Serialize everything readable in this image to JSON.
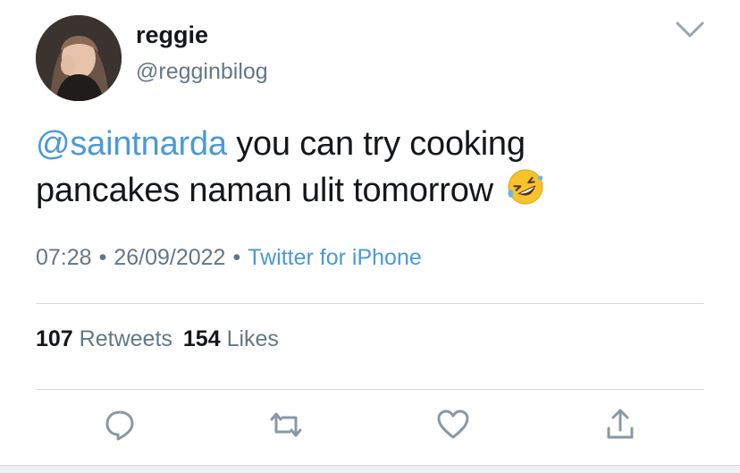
{
  "user": {
    "display_name": "reggie",
    "handle": "@regginbilog"
  },
  "tweet": {
    "mention": "@saintnarda",
    "text": " you can try cooking pancakes naman ulit tomorrow ",
    "emoji": "rolling-on-the-floor-laughing-emoji"
  },
  "meta": {
    "time": "07:28",
    "date": "26/09/2022",
    "separator": "•",
    "source": "Twitter for iPhone"
  },
  "stats": {
    "retweets_count": "107",
    "retweets_label": "Retweets",
    "likes_count": "154",
    "likes_label": "Likes"
  },
  "icons": {
    "menu": "chevron-down-icon",
    "reply": "reply-icon",
    "retweet": "retweet-icon",
    "like": "heart-icon",
    "share": "share-icon"
  },
  "colors": {
    "link": "#4a9ad6",
    "secondary_text": "#657786",
    "primary_text": "#14171a",
    "divider": "#d6dadd"
  }
}
